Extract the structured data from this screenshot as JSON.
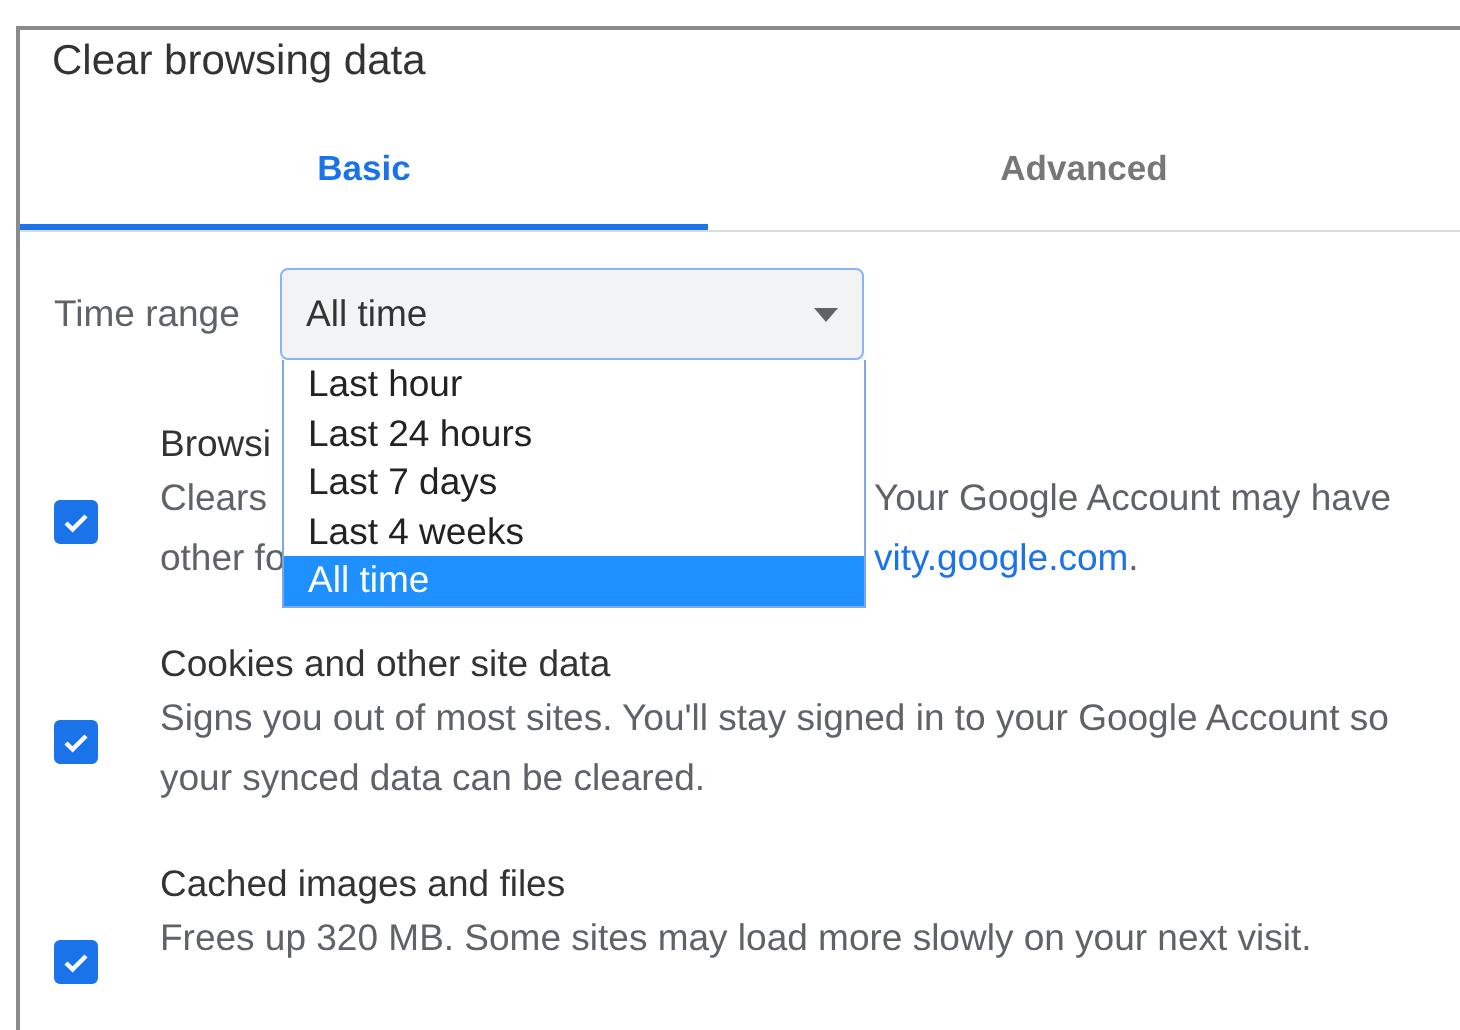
{
  "dialog": {
    "title": "Clear browsing data"
  },
  "tabs": [
    {
      "label": "Basic",
      "selected": true
    },
    {
      "label": "Advanced",
      "selected": false
    }
  ],
  "time_range": {
    "label": "Time range",
    "value": "All time",
    "options": [
      {
        "label": "Last hour",
        "selected": false
      },
      {
        "label": "Last 24 hours",
        "selected": false
      },
      {
        "label": "Last 7 days",
        "selected": false
      },
      {
        "label": "Last 4 weeks",
        "selected": false
      },
      {
        "label": "All time",
        "selected": true
      }
    ]
  },
  "items": [
    {
      "kind": "partly_hidden",
      "checked": true,
      "title": "Browsi",
      "lines": [
        {
          "left": "Clears",
          "right": "Your Google Account may have"
        },
        {
          "left": "other fo",
          "link": "vity.google.com",
          "right": "."
        }
      ]
    },
    {
      "kind": "full",
      "checked": true,
      "title": "Cookies and other site data",
      "lines": [
        {
          "text": "Signs you out of most sites. You'll stay signed in to your Google Account so"
        },
        {
          "text": "your synced data can be cleared."
        }
      ]
    },
    {
      "kind": "full",
      "checked": true,
      "title": "Cached images and files",
      "lines": [
        {
          "text": "Frees up 320 MB. Some sites may load more slowly on your next visit."
        }
      ]
    }
  ]
}
